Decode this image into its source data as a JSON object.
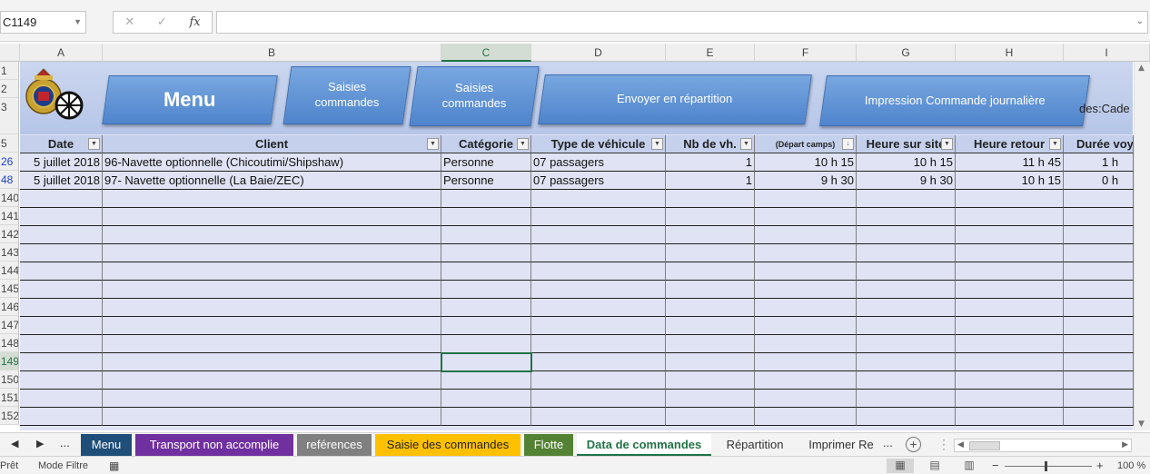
{
  "formula": {
    "namebox": "C1149",
    "fx": "fx",
    "cancel": "✕",
    "enter": "✓",
    "value": ""
  },
  "columns": [
    "A",
    "B",
    "C",
    "D",
    "E",
    "F",
    "G",
    "H",
    "I"
  ],
  "selected_column": "C",
  "row_numbers": [
    "1",
    "2",
    "3",
    "5",
    "26",
    "48",
    "140",
    "141",
    "142",
    "143",
    "144",
    "145",
    "146",
    "147",
    "148",
    "149",
    "150",
    "151",
    "152"
  ],
  "banner": {
    "menu_label": "Menu",
    "saisies1_label": "Saisies commandes",
    "saisies2_label": "Saisies commandes",
    "envoyer_label": "Envoyer en répartition",
    "impression_label": "Impression Commande journalière",
    "side_text": "des:Cade"
  },
  "table": {
    "headers": [
      "Date",
      "Client",
      "Catégorie",
      "Type de véhicule",
      "Nb de vh.",
      "(Départ camps)",
      "Heure sur site",
      "Heure retour",
      "Durée voy"
    ],
    "rows": [
      [
        "5 juillet 2018",
        "96-Navette optionnelle (Chicoutimi/Shipshaw)",
        "Personne",
        "07 passagers",
        "1",
        "10 h 15",
        "10 h 15",
        "11 h 45",
        "1 h"
      ],
      [
        "5 juillet 2018",
        "97- Navette optionnelle (La Baie/ZEC)",
        "Personne",
        "07 passagers",
        "1",
        "9 h 30",
        "9 h 30",
        "10 h 15",
        "0 h"
      ]
    ]
  },
  "sheet_tabs": {
    "ellipsis_left": "...",
    "ellipsis_right": "...",
    "tabs": [
      {
        "label": "Menu",
        "color": "#1f4e79",
        "text_color": "#ffffff"
      },
      {
        "label": "Transport non accomplie",
        "color": "#7030a0",
        "text_color": "#ffffff"
      },
      {
        "label": "reférences",
        "color": "#808080",
        "text_color": "#ffffff"
      },
      {
        "label": "Saisie des commandes",
        "color": "#ffc000",
        "text_color": "#222222"
      },
      {
        "label": "Flotte",
        "color": "#548235",
        "text_color": "#ffffff"
      },
      {
        "label": "Data de commandes",
        "color": "#ffffff",
        "text_color": "#217346"
      },
      {
        "label": "Répartition",
        "color": "#f3f3f3",
        "text_color": "#333333"
      },
      {
        "label": "Imprimer Re",
        "color": "#f3f3f3",
        "text_color": "#333333"
      }
    ],
    "active_tab": "Data de commandes"
  },
  "status": {
    "ready": "Prêt",
    "filter_mode": "Mode Filtre",
    "zoom": "100 %",
    "zoom_minus": "−",
    "zoom_plus": "+"
  },
  "colors": {
    "excel_green": "#217346",
    "header_blue": "#c4d0ec",
    "body_blue": "#dfe3f3",
    "button_blue": "#5b8fd6"
  },
  "icons": [
    "filter-icon",
    "dropdown-arrow-icon",
    "sort-filter-icon",
    "normal-view-icon",
    "page-layout-icon",
    "page-break-icon",
    "macro-record-icon",
    "logo-emblem"
  ]
}
